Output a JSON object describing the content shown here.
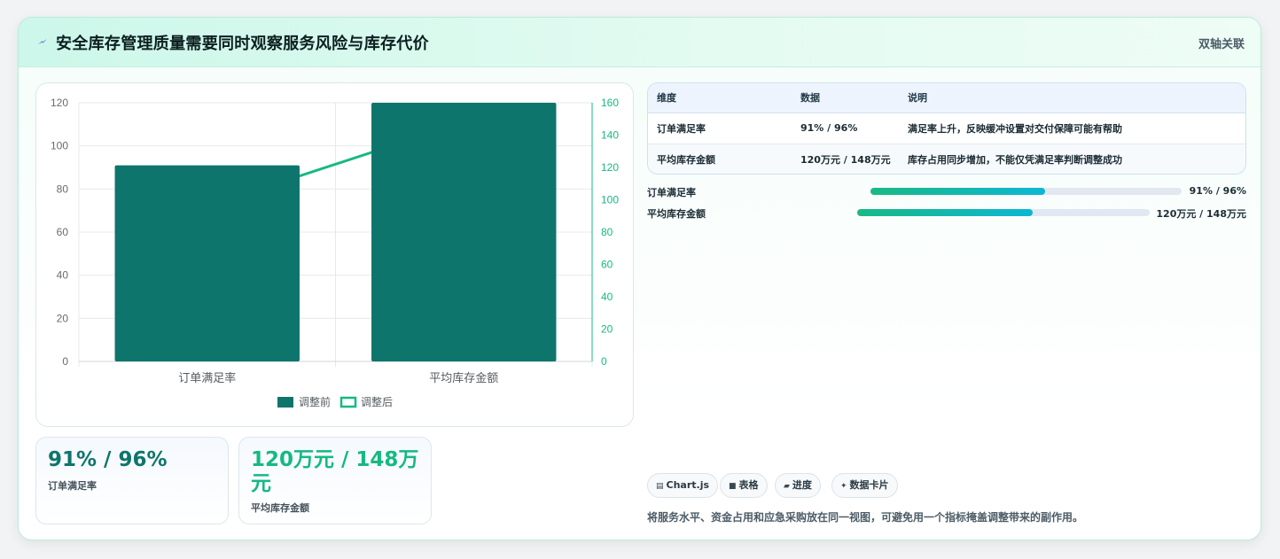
{
  "header": {
    "title": "安全库存管理质量需要同时观察服务风险与库存代价",
    "badge": "双轴关联"
  },
  "colors": {
    "before": "#0e756c",
    "after": "#16b981",
    "progress_start": "#19b985",
    "progress_end": "#0cb7d4"
  },
  "chart_data": {
    "type": "bar",
    "categories": [
      "订单满足率",
      "平均库存金额"
    ],
    "series": [
      {
        "name": "调整前",
        "type": "bar",
        "axis": "left",
        "values": [
          91,
          120
        ]
      },
      {
        "name": "调整后",
        "type": "line",
        "axis": "right",
        "values": [
          96,
          148
        ]
      }
    ],
    "y_left": {
      "min": 0,
      "max": 120,
      "ticks": [
        0,
        20,
        40,
        60,
        80,
        100,
        120
      ]
    },
    "y_right": {
      "min": 0,
      "max": 160,
      "ticks": [
        0,
        20,
        40,
        60,
        80,
        100,
        120,
        140,
        160
      ]
    },
    "grid": true,
    "legend": "bottom"
  },
  "stats": [
    {
      "value": "91% / 96%",
      "label": "订单满足率"
    },
    {
      "value": "120万元 / 148万元",
      "label": "平均库存金额"
    }
  ],
  "table": {
    "headers": [
      "维度",
      "数据",
      "说明"
    ],
    "rows": [
      [
        "订单满足率",
        "91% / 96%",
        "满足率上升，反映缓冲设置对交付保障可能有帮助"
      ],
      [
        "平均库存金额",
        "120万元 / 148万元",
        "库存占用同步增加，不能仅凭满足率判断调整成功"
      ]
    ]
  },
  "progress": [
    {
      "label": "订单满足率",
      "value_text": "91% / 96%",
      "fraction": 0.56
    },
    {
      "label": "平均库存金额",
      "value_text": "120万元 / 148万元",
      "fraction": 0.6
    }
  ],
  "tags": [
    {
      "icon": "chart-icon",
      "glyph": "▤",
      "label": "Chart.js"
    },
    {
      "icon": "table-icon",
      "glyph": "■",
      "label": "表格"
    },
    {
      "icon": "progress-icon",
      "glyph": "▰",
      "label": "进度"
    },
    {
      "icon": "sparkle-icon",
      "glyph": "✦",
      "label": "数据卡片"
    }
  ],
  "footer_note": "将服务水平、资金占用和应急采购放在同一视图，可避免用一个指标掩盖调整带来的副作用。"
}
